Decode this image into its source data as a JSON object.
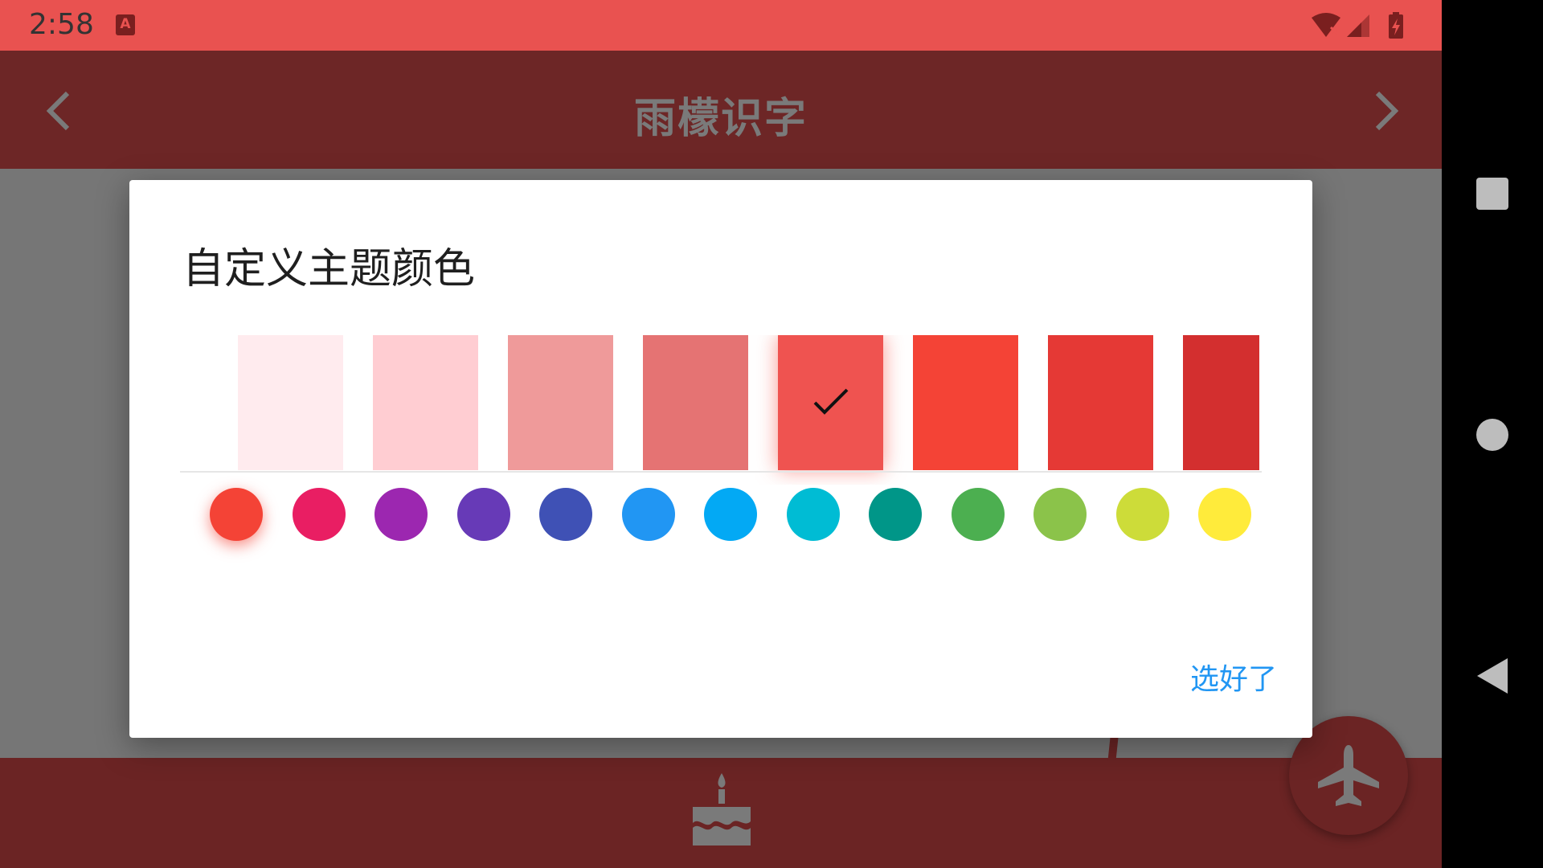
{
  "status_bar": {
    "time": "2:58",
    "notification_icon": "A",
    "icons": [
      "wifi-icon",
      "signal-icon",
      "battery-charging-icon"
    ]
  },
  "app_bar": {
    "title": "雨檬识字",
    "back_icon": "chevron-left-icon",
    "forward_icon": "chevron-right-icon"
  },
  "dialog": {
    "title": "自定义主题颜色",
    "shades": [
      {
        "color": "#ffebee",
        "selected": false
      },
      {
        "color": "#ffcdd2",
        "selected": false
      },
      {
        "color": "#ef9a9a",
        "selected": false
      },
      {
        "color": "#e57373",
        "selected": false
      },
      {
        "color": "#ef5350",
        "selected": true
      },
      {
        "color": "#f44336",
        "selected": false
      },
      {
        "color": "#e53935",
        "selected": false
      },
      {
        "color": "#d32f2f",
        "selected": false
      }
    ],
    "primary_colors": [
      {
        "color": "#f44336",
        "selected": true
      },
      {
        "color": "#e91e63",
        "selected": false
      },
      {
        "color": "#9c27b0",
        "selected": false
      },
      {
        "color": "#673ab7",
        "selected": false
      },
      {
        "color": "#3f51b5",
        "selected": false
      },
      {
        "color": "#2196f3",
        "selected": false
      },
      {
        "color": "#03a9f4",
        "selected": false
      },
      {
        "color": "#00bcd4",
        "selected": false
      },
      {
        "color": "#009688",
        "selected": false
      },
      {
        "color": "#4caf50",
        "selected": false
      },
      {
        "color": "#8bc34a",
        "selected": false
      },
      {
        "color": "#cddc39",
        "selected": false
      },
      {
        "color": "#ffeb3b",
        "selected": false
      }
    ],
    "done_label": "选好了"
  },
  "bottom_bar": {
    "center_icon": "cake-icon",
    "fab_icon": "airplane-icon"
  },
  "system_nav": {
    "icons": [
      "recents-square-icon",
      "home-circle-icon",
      "back-triangle-icon"
    ]
  }
}
